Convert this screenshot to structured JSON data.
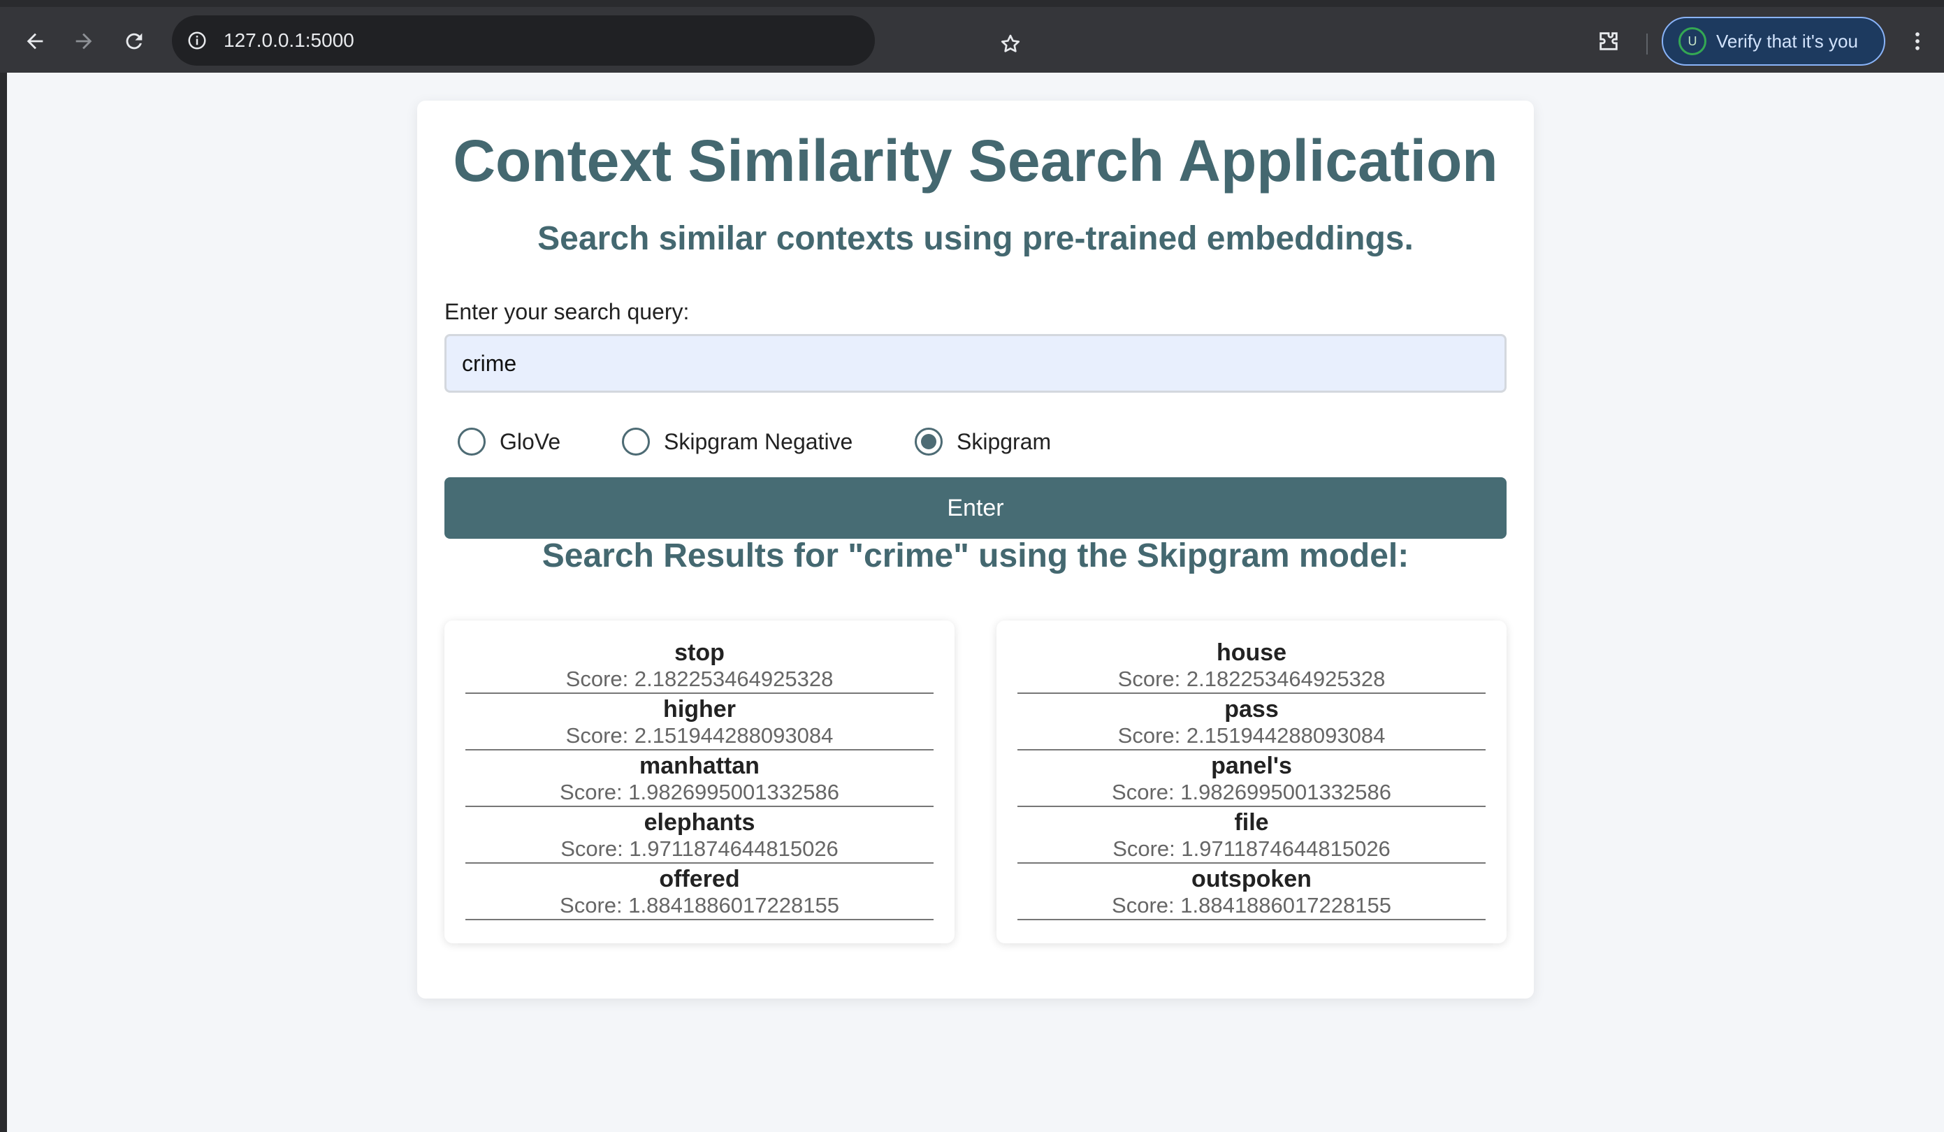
{
  "browser": {
    "url": "127.0.0.1:5000",
    "profile_initial": "U",
    "verify_label": "Verify that it's you"
  },
  "app": {
    "title": "Context Similarity Search Application",
    "subtitle": "Search similar contexts using pre-trained embeddings.",
    "query_label": "Enter your search query:",
    "query_value": "crime",
    "models": [
      {
        "label": "GloVe",
        "checked": false
      },
      {
        "label": "Skipgram Negative",
        "checked": false
      },
      {
        "label": "Skipgram",
        "checked": true
      }
    ],
    "enter_label": "Enter",
    "results_heading": "Search Results for \"crime\" using the Skipgram model:"
  },
  "results": {
    "left": [
      {
        "word": "stop",
        "score": "Score: 2.182253464925328"
      },
      {
        "word": "higher",
        "score": "Score: 2.151944288093084"
      },
      {
        "word": "manhattan",
        "score": "Score: 1.9826995001332586"
      },
      {
        "word": "elephants",
        "score": "Score: 1.9711874644815026"
      },
      {
        "word": "offered",
        "score": "Score: 1.8841886017228155"
      }
    ],
    "right": [
      {
        "word": "house",
        "score": "Score: 2.182253464925328"
      },
      {
        "word": "pass",
        "score": "Score: 2.151944288093084"
      },
      {
        "word": "panel's",
        "score": "Score: 1.9826995001332586"
      },
      {
        "word": "file",
        "score": "Score: 1.9711874644815026"
      },
      {
        "word": "outspoken",
        "score": "Score: 1.8841886017228155"
      }
    ]
  },
  "colors": {
    "accent": "#476c74",
    "heading": "#446870",
    "input_bg": "#e8effd"
  }
}
